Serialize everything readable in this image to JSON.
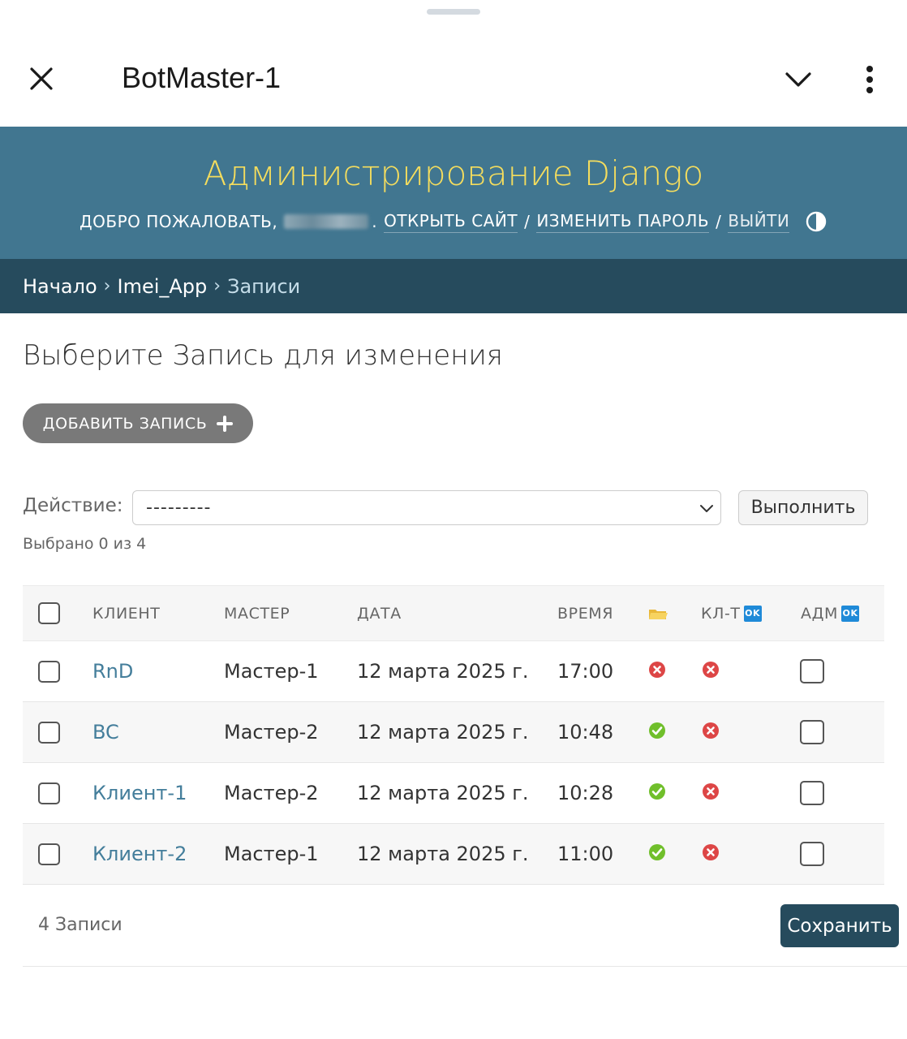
{
  "sheet": {
    "title": "BotMaster-1"
  },
  "header": {
    "branding": "Администрирование Django",
    "welcome_prefix": "ДОБРО ПОЖАЛОВАТЬ,",
    "welcome_suffix": ".",
    "view_site": "ОТКРЫТЬ САЙТ",
    "change_password": "ИЗМЕНИТЬ ПАРОЛЬ",
    "logout": "ВЫЙТИ",
    "separator": "/"
  },
  "breadcrumbs": {
    "home": "Начало",
    "app": "Imei_App",
    "current": "Записи",
    "arrow": "›"
  },
  "content": {
    "title": "Выберите Запись для изменения",
    "add_button": "ДОБАВИТЬ ЗАПИСЬ"
  },
  "actions": {
    "label": "Действие:",
    "selected_option": "---------",
    "run_button": "Выполнить",
    "selected_count": "Выбрано 0 из 4"
  },
  "table": {
    "headers": {
      "client": "КЛИЕНТ",
      "master": "МАСТЕР",
      "date": "ДАТА",
      "time": "ВРЕМЯ",
      "client_flag": "КЛ-Т",
      "admin_flag": "АДМ",
      "ok_badge": "OK"
    },
    "rows": [
      {
        "client": "RnD",
        "master": "Мастер-1",
        "date": "12 марта 2025 г.",
        "time": "17:00",
        "status": "no",
        "client_confirmed": "no",
        "admin_checked": false
      },
      {
        "client": "BC",
        "master": "Мастер-2",
        "date": "12 марта 2025 г.",
        "time": "10:48",
        "status": "yes",
        "client_confirmed": "no",
        "admin_checked": false
      },
      {
        "client": "Клиент-1",
        "master": "Мастер-2",
        "date": "12 марта 2025 г.",
        "time": "10:28",
        "status": "yes",
        "client_confirmed": "no",
        "admin_checked": false
      },
      {
        "client": "Клиент-2",
        "master": "Мастер-1",
        "date": "12 марта 2025 г.",
        "time": "11:00",
        "status": "yes",
        "client_confirmed": "no",
        "admin_checked": false
      }
    ]
  },
  "footer": {
    "count": "4 Записи",
    "save_button": "Сохранить"
  },
  "colors": {
    "header_bg": "#417690",
    "breadcrumb_bg": "#264b5d",
    "branding": "#f5dd5d",
    "link": "#447e9b",
    "yes_icon": "#70bf2b",
    "no_icon": "#dd4646"
  }
}
